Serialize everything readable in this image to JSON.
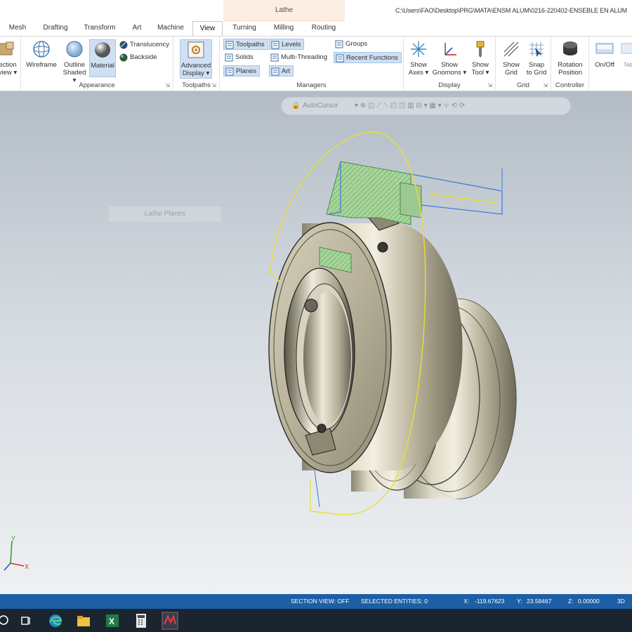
{
  "window": {
    "context_tab_group": "Lathe",
    "file_path": "C:\\Users\\FAO\\Desktop\\PRG\\MATA\\ENSM ALUM\\0216-220402-ENSEBLE EN ALUM"
  },
  "tabs": [
    "Mesh",
    "Drafting",
    "Transform",
    "Art",
    "Machine",
    "View",
    "Turning",
    "Milling",
    "Routing"
  ],
  "active_tab": "View",
  "ribbon": {
    "section_view": {
      "line1": "ection",
      "line2": "view ▾"
    },
    "appearance": {
      "label": "Appearance",
      "wireframe": "Wireframe",
      "outline_line1": "Outline",
      "outline_line2": "Shaded ▾",
      "material": "Material",
      "translucency": "Translucency",
      "backside": "Backside"
    },
    "toolpaths": {
      "label": "Toolpaths",
      "advanced_line1": "Advanced",
      "advanced_line2": "Display ▾"
    },
    "managers": {
      "label": "Managers",
      "toolpaths": "Toolpaths",
      "solids": "Solids",
      "planes": "Planes",
      "levels": "Levels",
      "multi_threading": "Multi-Threading",
      "art": "Art",
      "groups": "Groups",
      "recent_functions": "Recent Functions"
    },
    "display": {
      "label": "Display",
      "show_axes_1": "Show",
      "show_axes_2": "Axes ▾",
      "show_gnomons_1": "Show",
      "show_gnomons_2": "Gnomons ▾",
      "show_tool_1": "Show",
      "show_tool_2": "Tool ▾"
    },
    "grid": {
      "label": "Grid",
      "show_grid_1": "Show",
      "show_grid_2": "Grid",
      "snap_grid_1": "Snap",
      "snap_grid_2": "to Grid"
    },
    "controller": {
      "label": "Controller",
      "rotation_1": "Rotation",
      "rotation_2": "Position"
    },
    "extra": {
      "on_off": "On/Off",
      "next_partial": "Ne"
    }
  },
  "viewport": {
    "autocursor_label": "AutoCursor",
    "ghost_label": "Lathe Planes",
    "axis_y": "Y",
    "axis_x": "X"
  },
  "status": {
    "section_view": "SECTION VIEW: OFF",
    "selected_entities": "SELECTED ENTITIES: 0",
    "x_label": "X:",
    "x_value": "-119.67623",
    "y_label": "Y:",
    "y_value": "23.58467",
    "z_label": "Z:",
    "z_value": "0.00000",
    "mode": "3D"
  },
  "colors": {
    "status_bar": "#1d5fa6",
    "taskbar": "#1b2530",
    "selection_highlight": "#cfe0f2",
    "toolpath_yellow": "#e8e030",
    "part_metal": "#c9c4ad"
  }
}
